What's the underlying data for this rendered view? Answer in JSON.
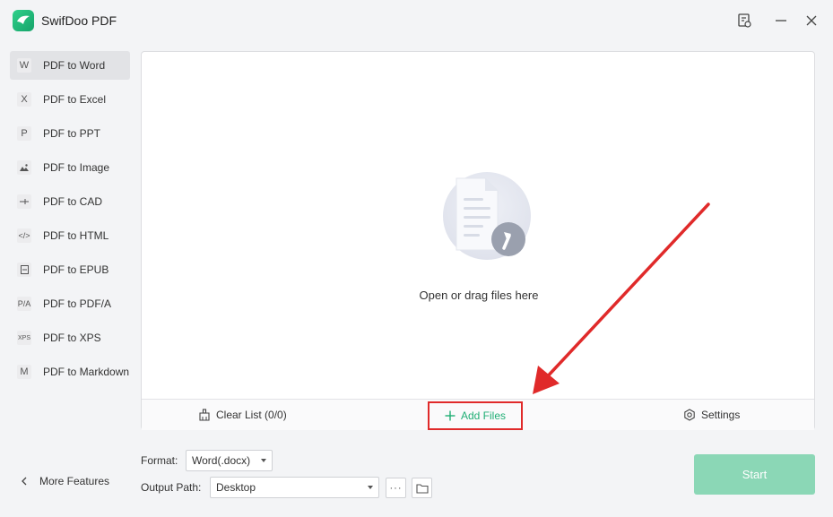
{
  "app": {
    "title": "SwifDoo PDF"
  },
  "sidebar": {
    "items": [
      {
        "label": "PDF to Word",
        "icon": "W",
        "active": true
      },
      {
        "label": "PDF to Excel",
        "icon": "X"
      },
      {
        "label": "PDF to PPT",
        "icon": "P"
      },
      {
        "label": "PDF to Image",
        "icon": "image-icon"
      },
      {
        "label": "PDF to CAD",
        "icon": "cad-icon"
      },
      {
        "label": "PDF to HTML",
        "icon": "</>"
      },
      {
        "label": "PDF to EPUB",
        "icon": "epub-icon"
      },
      {
        "label": "PDF to PDF/A",
        "icon": "P/A"
      },
      {
        "label": "PDF to XPS",
        "icon": "XPS"
      },
      {
        "label": "PDF to Markdown",
        "icon": "M"
      }
    ],
    "more_features": "More Features"
  },
  "drop_area": {
    "prompt": "Open or drag files here",
    "clear_list": "Clear List (0/0)",
    "add_files": "Add Files",
    "settings": "Settings"
  },
  "bottom": {
    "format_label": "Format:",
    "format_value": "Word(.docx)",
    "output_label": "Output Path:",
    "output_value": "Desktop",
    "more_dots": "···",
    "start": "Start"
  },
  "colors": {
    "accent": "#1fae74",
    "start_button": "#8bd7b6",
    "annotation": "#e02a2a"
  }
}
